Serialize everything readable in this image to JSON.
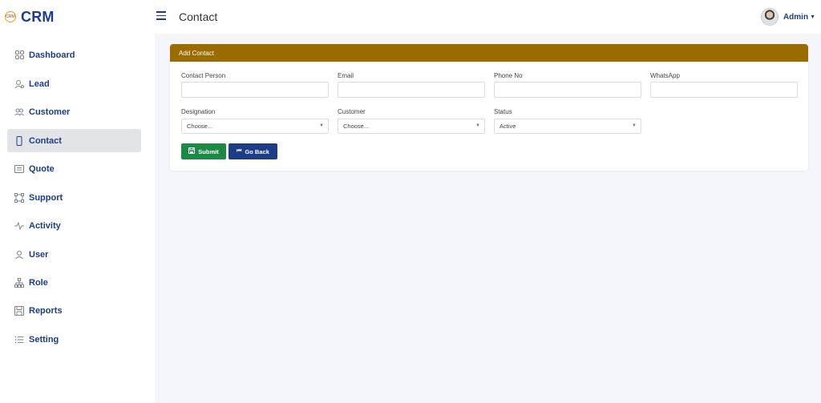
{
  "brand": {
    "name": "CRM",
    "logo_text": "CRM"
  },
  "header": {
    "title": "Contact",
    "user_name": "Admin"
  },
  "sidebar": {
    "items": [
      {
        "label": "Dashboard",
        "icon": "dashboard-icon"
      },
      {
        "label": "Lead",
        "icon": "lead-icon"
      },
      {
        "label": "Customer",
        "icon": "customer-icon"
      },
      {
        "label": "Contact",
        "icon": "contact-icon",
        "active": true
      },
      {
        "label": "Quote",
        "icon": "quote-icon"
      },
      {
        "label": "Support",
        "icon": "support-icon"
      },
      {
        "label": "Activity",
        "icon": "activity-icon"
      },
      {
        "label": "User",
        "icon": "user-icon"
      },
      {
        "label": "Role",
        "icon": "role-icon"
      },
      {
        "label": "Reports",
        "icon": "reports-icon"
      },
      {
        "label": "Setting",
        "icon": "setting-icon"
      }
    ]
  },
  "form": {
    "title": "Add Contact",
    "contact_person": {
      "label": "Contact Person",
      "value": ""
    },
    "email": {
      "label": "Email",
      "value": ""
    },
    "phone": {
      "label": "Phone No",
      "value": ""
    },
    "whatsapp": {
      "label": "WhatsApp",
      "value": ""
    },
    "designation": {
      "label": "Designation",
      "selected": "Choose..."
    },
    "customer": {
      "label": "Customer",
      "selected": "Choose..."
    },
    "status": {
      "label": "Status",
      "selected": "Active"
    },
    "submit_label": "Submit",
    "back_label": "Go Back"
  },
  "colors": {
    "brand": "#1d3c87",
    "card_header": "#9a6c00",
    "submit": "#1a8a45",
    "back": "#1d3c87",
    "background": "#f4f6fc"
  }
}
